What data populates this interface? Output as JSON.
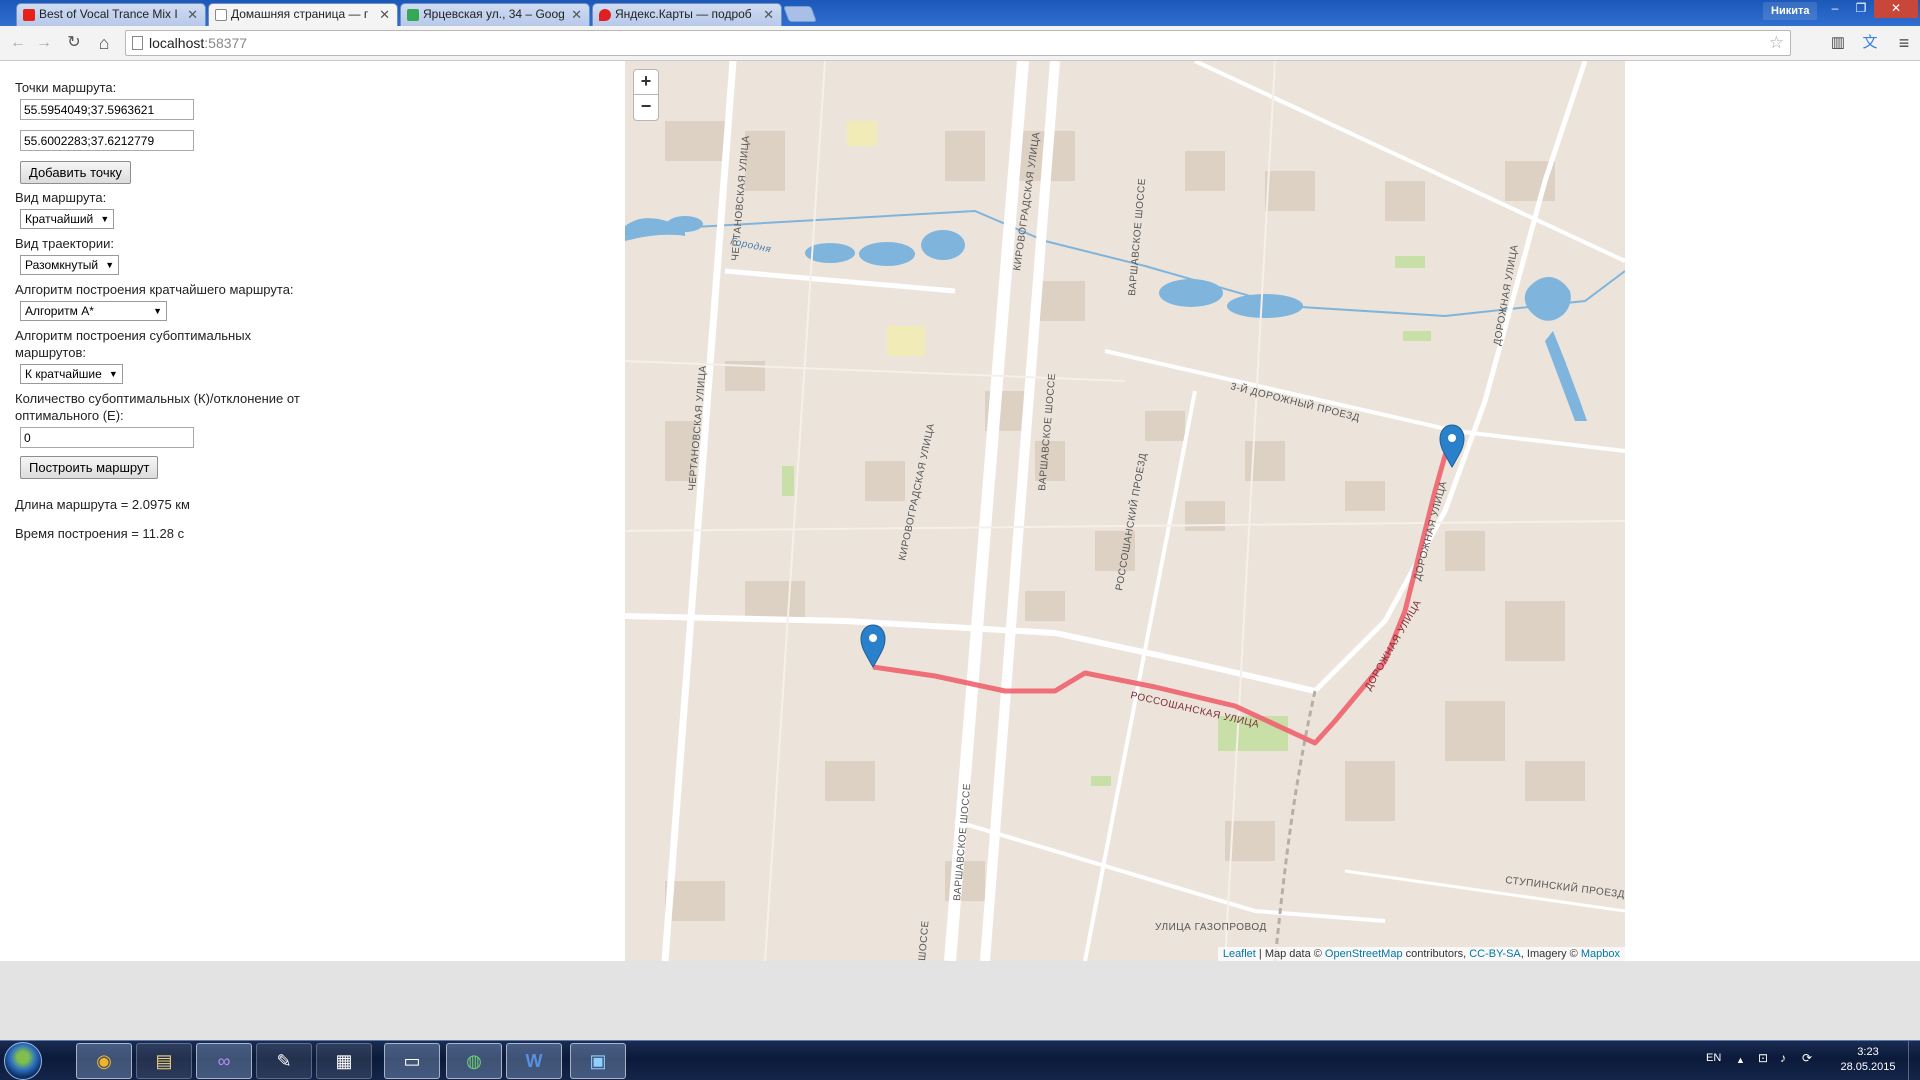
{
  "browser": {
    "tabs": [
      {
        "title": "Best of Vocal Trance Mix I",
        "favicon_color": "#e62117"
      },
      {
        "title": "Домашняя страница — г",
        "favicon_color": "#ffffff"
      },
      {
        "title": "Ярцевская ул., 34 – Goog",
        "favicon_color": "#34a853"
      },
      {
        "title": "Яндекс.Карты — подроб",
        "favicon_color": "#e02020"
      }
    ],
    "tab_close": "✕",
    "user": "Никита",
    "win_controls": {
      "minimize": "–",
      "restore": "❐",
      "close": "✕"
    },
    "nav": {
      "back": "←",
      "forward": "→",
      "reload": "↻",
      "home": "⌂"
    },
    "url_host": "localhost",
    "url_port": ":58377",
    "star": "☆",
    "extensions": [
      "▥",
      "文",
      "≡"
    ]
  },
  "form": {
    "points_label": "Точки маршрута:",
    "point1": "55.5954049;37.5963621",
    "point2": "55.6002283;37.6212779",
    "add_point_button": "Добавить точку",
    "route_type_label": "Вид маршрута:",
    "route_type_value": "Кратчайший",
    "trajectory_label": "Вид траектории:",
    "trajectory_value": "Разомкнутый",
    "shortest_algo_label": "Алгоритм построения кратчайшего маршрута:",
    "shortest_algo_value": "Алгоритм A*",
    "subopt_algo_label": "Алгоритм построения субоптимальных маршрутов:",
    "subopt_algo_value": "К кратчайшие",
    "count_label": "Количество субоптимальных (К)/отклонение от оптимального (E):",
    "count_value": "0",
    "build_button": "Построить маршрут",
    "select_arrow": "▼"
  },
  "result": {
    "length": "Длина маршрута = 2.0975 км",
    "time": "Время построения = 11.28 с"
  },
  "map": {
    "zoom_in": "+",
    "zoom_out": "−",
    "route_color": "#f0626e",
    "marker_color": "#2a81cb",
    "water_color": "#7fb4dd",
    "labels": [
      {
        "text": "ЧЕРТАНОВСКАЯ УЛИЦА"
      },
      {
        "text": "КИРОВОГРАДСКАЯ УЛИЦА"
      },
      {
        "text": "ВАРШАВСКОЕ ШОССЕ"
      },
      {
        "text": "ДОРОЖНАЯ УЛИЦА"
      },
      {
        "text": "3-Й ДОРОЖНЫЙ ПРОЕЗД"
      },
      {
        "text": "ВАРШАВСКОЕ ШОССЕ"
      },
      {
        "text": "ЧЕРТАНОВСКАЯ УЛИЦА"
      },
      {
        "text": "КИРОВОГРАДСКАЯ УЛИЦА"
      },
      {
        "text": "РОССОШАНСКИЙ ПРОЕЗД"
      },
      {
        "text": "ДОРОЖНАЯ УЛИЦА"
      },
      {
        "text": "РОССОШАНСКАЯ УЛИЦА"
      },
      {
        "text": "ДОРОЖНАЯ УЛИЦА"
      },
      {
        "text": "ВАРШАВСКОЕ ШОССЕ"
      },
      {
        "text": "СТУПИНСКИЙ ПРОЕЗД"
      },
      {
        "text": "УЛИЦА ГАЗОПРОВОД"
      },
      {
        "text": "ШОССЕ"
      },
      {
        "text": "Городня"
      }
    ],
    "attribution": {
      "leaflet": "Leaflet",
      "sep": " | Map data © ",
      "osm": "OpenStreetMap",
      "contrib": " contributors, ",
      "license": "CC-BY-SA",
      "imagery": ", Imagery © ",
      "mapbox": "Mapbox"
    }
  },
  "taskbar": {
    "apps": [
      "chrome",
      "explorer",
      "visual-studio",
      "tools",
      "calculator",
      "cmd",
      "network-globe",
      "word",
      "remote-desktop"
    ],
    "app_glyphs": [
      "◉",
      "▤",
      "∞",
      "✎",
      "▦",
      "▭",
      "◍",
      "W",
      "▣"
    ],
    "lang": "EN",
    "tray_icons": [
      "▲",
      "⊡",
      "♪",
      "⟳"
    ],
    "time": "3:23",
    "date": "28.05.2015"
  }
}
